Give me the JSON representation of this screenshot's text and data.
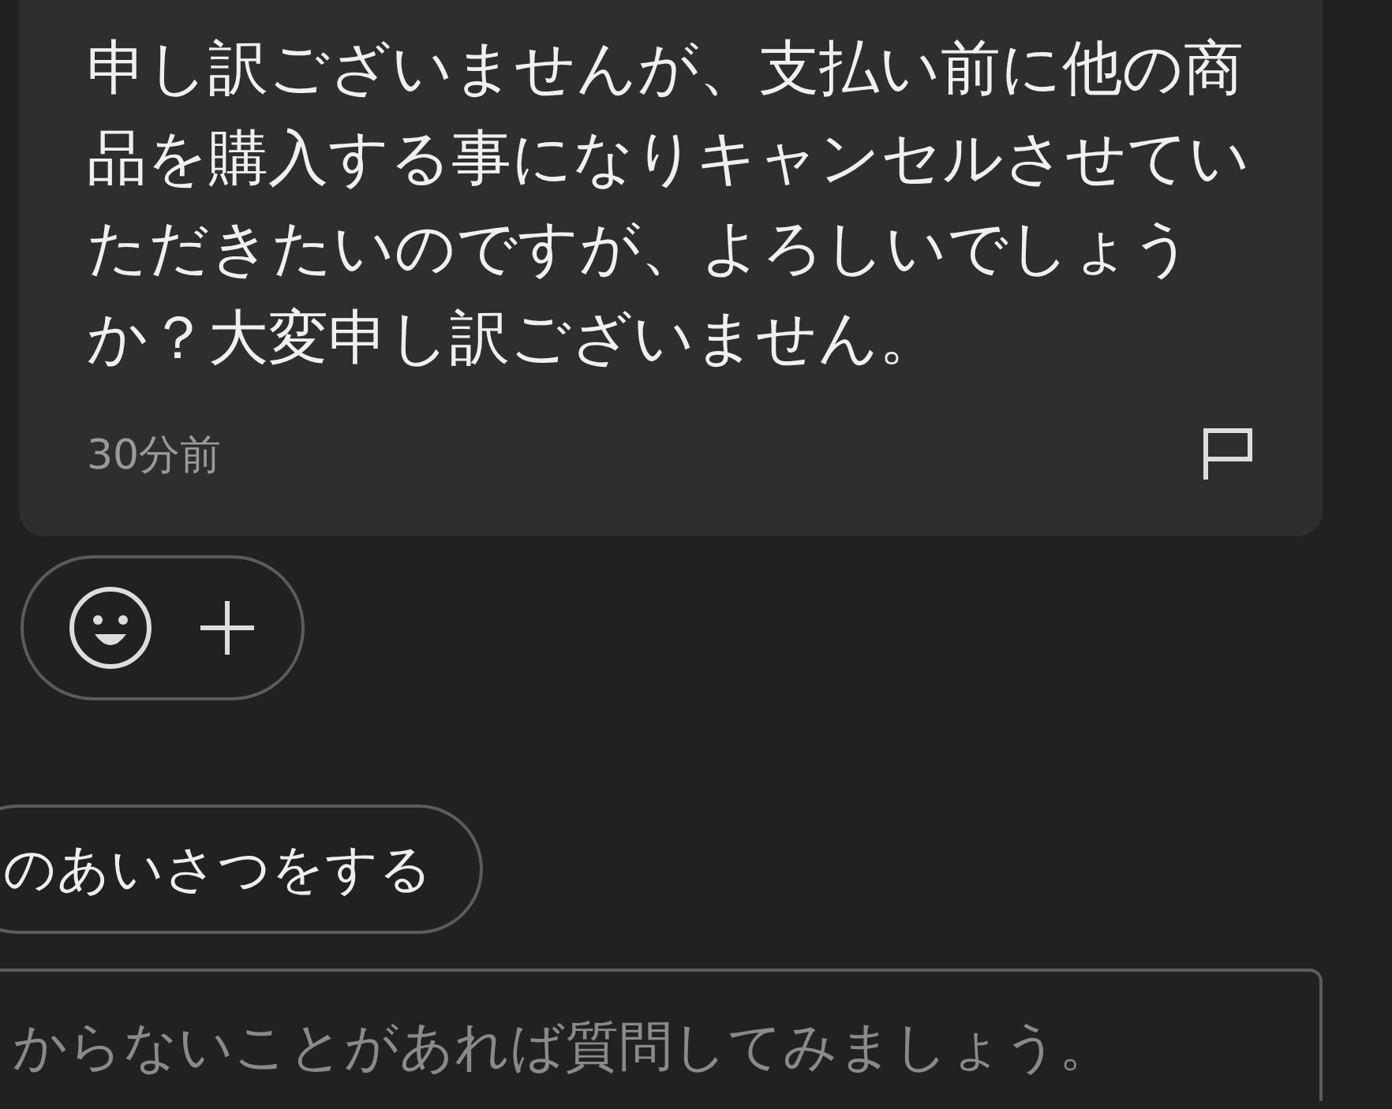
{
  "message": {
    "text": "申し訳ございませんが、支払い前に他の商品を購入する事になりキャンセルさせていただきたいのですが、よろしいでしょうか？大変申し訳ございません。",
    "time": "30分前"
  },
  "suggestion": {
    "label": "のあいさつをする"
  },
  "composer": {
    "placeholder": "からないことがあれば質問してみましょう。"
  }
}
